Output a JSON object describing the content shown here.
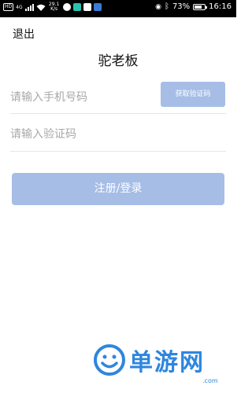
{
  "status_bar": {
    "hd_label": "HD",
    "network": "4G",
    "speed_value": "29.1",
    "speed_unit": "K/s",
    "battery_percent": "73%",
    "battery_level": 0.73,
    "time": "16:16"
  },
  "header": {
    "back_label": "退出",
    "title": "驼老板"
  },
  "form": {
    "phone_placeholder": "请输入手机号码",
    "phone_value": "",
    "get_code_label": "获取验证码",
    "code_placeholder": "请输入验证码",
    "code_value": "",
    "submit_label": "注册/登录"
  },
  "watermark": {
    "brand": "单游网",
    "domain": ".com",
    "icon": "smiley-face-icon"
  },
  "colors": {
    "primary_button": "#a6bde6",
    "watermark": "#2e86de"
  }
}
